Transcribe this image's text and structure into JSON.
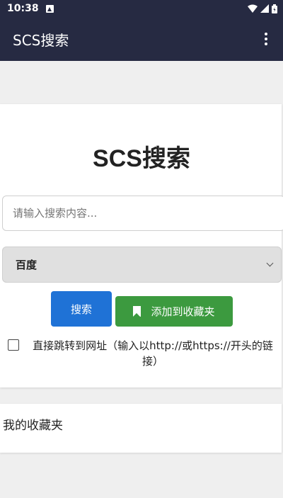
{
  "status_bar": {
    "time": "10:38",
    "notification_icon": "notification-a-icon",
    "icons": [
      "wifi-icon",
      "signal-icon",
      "battery-icon"
    ]
  },
  "app_bar": {
    "title": "SCS搜索",
    "menu_icon": "more-vertical-icon"
  },
  "search": {
    "heading": "SCS搜索",
    "placeholder": "请输入搜索内容...",
    "value": "",
    "engine_selected": "百度",
    "search_button": "搜索",
    "favorite_button": "添加到收藏夹",
    "direct_jump_label": "直接跳转到网址（输入以http://或https://开头的链接）",
    "direct_jump_checked": false
  },
  "favorites": {
    "title": "我的收藏夹"
  },
  "colors": {
    "app_bar": "#262a42",
    "search_button": "#1f72d6",
    "favorite_button": "#3c9a3f",
    "select_bg": "#e0e0e0"
  }
}
